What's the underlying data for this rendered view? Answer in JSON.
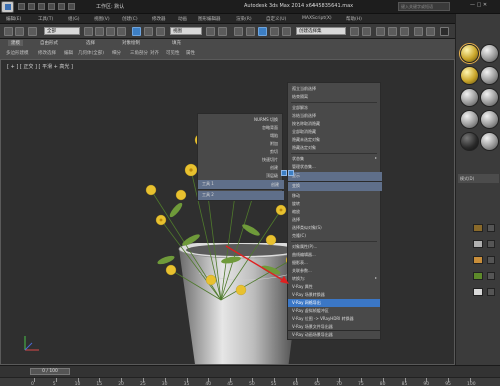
{
  "titlebar": {
    "workspace": "工作区: 默认",
    "app_title": "Autodesk 3ds Max  2014 x64",
    "file_title": "445835641.max",
    "search_placeholder": "键入关键字或短语",
    "window_controls": "— □ ✕"
  },
  "menubar": {
    "items": [
      "编辑(E)",
      "工具(T)",
      "组(G)",
      "视图(V)",
      "创建(C)",
      "修改器",
      "动画",
      "图形编辑器",
      "渲染(R)",
      "自定义(U)",
      "MAXScript(X)",
      "帮助(H)"
    ]
  },
  "toolbar": {
    "filter_value": "全部",
    "coord_value": "视图",
    "selection_set": "创建选择集"
  },
  "ribbon": {
    "tabs": [
      "建模",
      "自由形式",
      "选择",
      "对象绘制",
      "填充"
    ],
    "active_tab": "建模",
    "subtabs": [
      "多边形建模",
      "修改选择",
      "编辑",
      "几何体(全部)",
      "细分",
      "三角剖分",
      "对齐",
      "可见性",
      "属性"
    ]
  },
  "viewport": {
    "label": "[ + ] [ 正交 ] [ 平滑 + 高光 ]",
    "background": "#2f2f2f"
  },
  "quad_top_left": {
    "items": [
      "NURMS 切换",
      "忽略背面",
      "塌陷",
      "附加",
      "剪切",
      "快速切片",
      "创建"
    ],
    "bar_label": "工具 1",
    "header_label": "顶层级"
  },
  "quad_top_right": {
    "items": [
      "孤立当前选择",
      "结束隔离",
      "全部解冻",
      "冻结当前选择",
      "按名称取消隐藏",
      "全部取消隐藏",
      "隐藏未选定对象",
      "隐藏选定对象",
      "状态集",
      "管理状态集..."
    ],
    "bar_label": "显示"
  },
  "quad_bottom_left": {
    "bar_label": "工具 2",
    "bottom_label": "创建"
  },
  "quad_bottom_right": {
    "items": [
      "移动",
      "旋转",
      "缩放",
      "选择",
      "选择类似对象(S)",
      "克隆(C)",
      "对象属性(P)...",
      "曲线编辑器...",
      "摄影表...",
      "关联参数...",
      "转换为:",
      "V-Ray 属性",
      "V-Ray 场景转换器",
      "V-Ray 网格导出",
      "V-Ray 虚拟帧缓冲区",
      "V-Ray 位图 -> VRayHDRI 转换器",
      "V-Ray 场景文件导出器",
      "V-Ray 动画场景导出器"
    ],
    "highlighted_index": 13,
    "bar_label": "变换"
  },
  "command_panel": {
    "tab_label": "模式(D)",
    "material_rows": 5
  },
  "timeline": {
    "slider_label": "0 / 100",
    "ticks": [
      "0",
      "5",
      "10",
      "15",
      "20",
      "25",
      "30",
      "35",
      "40",
      "45",
      "50",
      "55",
      "60",
      "65",
      "70",
      "75",
      "80",
      "85",
      "90",
      "95",
      "100"
    ]
  },
  "colors": {
    "highlight": "#3b77c6",
    "annotation_arrow": "#e02020",
    "menu_bg": "#494949",
    "flower": "#e8c12f"
  }
}
